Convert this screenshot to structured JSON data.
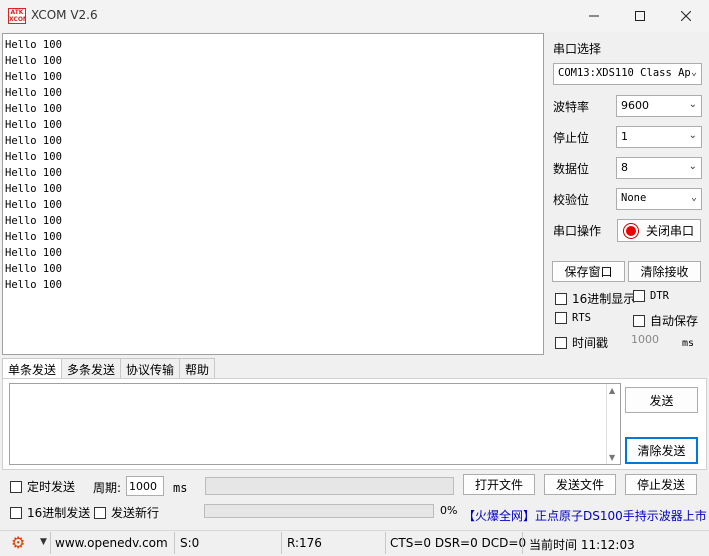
{
  "window": {
    "logo_text": "ATK XCOM",
    "title": "XCOM V2.6"
  },
  "receive": {
    "lines": [
      "Hello 100",
      "Hello 100",
      "Hello 100",
      "Hello 100",
      "Hello 100",
      "Hello 100",
      "Hello 100",
      "Hello 100",
      "Hello 100",
      "Hello 100",
      "Hello 100",
      "Hello 100",
      "Hello 100",
      "Hello 100",
      "Hello 100",
      "Hello 100"
    ]
  },
  "settings": {
    "port_label": "串口选择",
    "port_value": "COM13:XDS110 Class Ap",
    "baud_label": "波特率",
    "baud_value": "9600",
    "stop_label": "停止位",
    "stop_value": "1",
    "data_label": "数据位",
    "data_value": "8",
    "parity_label": "校验位",
    "parity_value": "None",
    "op_label": "串口操作",
    "close_port": "关闭串口",
    "save_window": "保存窗口",
    "clear_receive": "清除接收",
    "hex_display": "16进制显示",
    "dtr": "DTR",
    "rts": "RTS",
    "auto_save": "自动保存",
    "timestamp": "时间戳",
    "timestamp_ms": "1000",
    "ms_unit": "ms"
  },
  "tabs": [
    "单条发送",
    "多条发送",
    "协议传输",
    "帮助"
  ],
  "send": {
    "send_button": "发送",
    "clear_send": "清除发送",
    "timed_send": "定时发送",
    "period_label": "周期:",
    "period_value": "1000",
    "ms_unit": "ms",
    "open_file": "打开文件",
    "send_file": "发送文件",
    "stop_send": "停止发送",
    "hex_send": "16进制发送",
    "send_newline": "发送新行",
    "progress_text": "0%",
    "progress_value": 0,
    "promo": "【火爆全网】正点原子DS100手持示波器上市"
  },
  "status": {
    "url": "www.openedv.com",
    "sent": "S:0",
    "received": "R:176",
    "lines": "CTS=0 DSR=0 DCD=0",
    "time": "当前时间 11:12:03"
  },
  "colors": {
    "accent": "#0078d7",
    "stop_dot": "#e00000",
    "link": "#0000c8"
  }
}
